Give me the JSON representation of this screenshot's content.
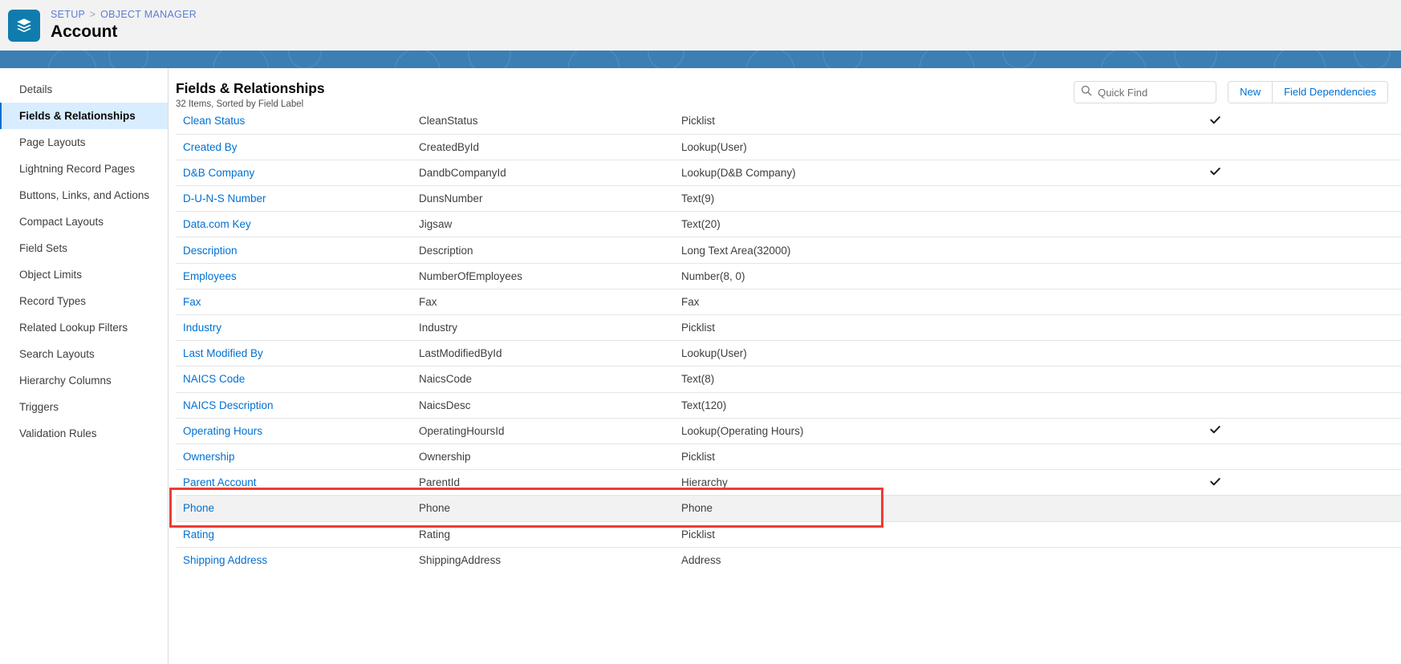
{
  "header": {
    "icon": "layers-stack-icon",
    "icon_bg": "#107cad",
    "breadcrumb": {
      "setup": "SETUP",
      "separator": ">",
      "object_manager": "OBJECT MANAGER"
    },
    "title": "Account"
  },
  "sidebar": {
    "items": [
      {
        "label": "Details",
        "active": false
      },
      {
        "label": "Fields & Relationships",
        "active": true
      },
      {
        "label": "Page Layouts",
        "active": false
      },
      {
        "label": "Lightning Record Pages",
        "active": false
      },
      {
        "label": "Buttons, Links, and Actions",
        "active": false
      },
      {
        "label": "Compact Layouts",
        "active": false
      },
      {
        "label": "Field Sets",
        "active": false
      },
      {
        "label": "Object Limits",
        "active": false
      },
      {
        "label": "Record Types",
        "active": false
      },
      {
        "label": "Related Lookup Filters",
        "active": false
      },
      {
        "label": "Search Layouts",
        "active": false
      },
      {
        "label": "Hierarchy Columns",
        "active": false
      },
      {
        "label": "Triggers",
        "active": false
      },
      {
        "label": "Validation Rules",
        "active": false
      }
    ]
  },
  "main": {
    "list_title": "Fields & Relationships",
    "list_subtitle": "32 Items, Sorted by Field Label",
    "search": {
      "icon": "search-icon",
      "placeholder": "Quick Find",
      "value": ""
    },
    "buttons": [
      {
        "label": "New"
      },
      {
        "label": "Field Dependencies"
      }
    ],
    "accent_link_color": "#0070d2",
    "highlight_color": "#ef3b35",
    "rows": [
      {
        "label": "Clean Status",
        "api_name": "CleanStatus",
        "data_type": "Picklist",
        "indexed": true,
        "highlighted": false
      },
      {
        "label": "Created By",
        "api_name": "CreatedById",
        "data_type": "Lookup(User)",
        "indexed": false,
        "highlighted": false
      },
      {
        "label": "D&B Company",
        "api_name": "DandbCompanyId",
        "data_type": "Lookup(D&B Company)",
        "indexed": true,
        "highlighted": false
      },
      {
        "label": "D-U-N-S Number",
        "api_name": "DunsNumber",
        "data_type": "Text(9)",
        "indexed": false,
        "highlighted": false
      },
      {
        "label": "Data.com Key",
        "api_name": "Jigsaw",
        "data_type": "Text(20)",
        "indexed": false,
        "highlighted": false
      },
      {
        "label": "Description",
        "api_name": "Description",
        "data_type": "Long Text Area(32000)",
        "indexed": false,
        "highlighted": false
      },
      {
        "label": "Employees",
        "api_name": "NumberOfEmployees",
        "data_type": "Number(8, 0)",
        "indexed": false,
        "highlighted": false
      },
      {
        "label": "Fax",
        "api_name": "Fax",
        "data_type": "Fax",
        "indexed": false,
        "highlighted": false
      },
      {
        "label": "Industry",
        "api_name": "Industry",
        "data_type": "Picklist",
        "indexed": false,
        "highlighted": false
      },
      {
        "label": "Last Modified By",
        "api_name": "LastModifiedById",
        "data_type": "Lookup(User)",
        "indexed": false,
        "highlighted": false
      },
      {
        "label": "NAICS Code",
        "api_name": "NaicsCode",
        "data_type": "Text(8)",
        "indexed": false,
        "highlighted": false
      },
      {
        "label": "NAICS Description",
        "api_name": "NaicsDesc",
        "data_type": "Text(120)",
        "indexed": false,
        "highlighted": false
      },
      {
        "label": "Operating Hours",
        "api_name": "OperatingHoursId",
        "data_type": "Lookup(Operating Hours)",
        "indexed": true,
        "highlighted": false
      },
      {
        "label": "Ownership",
        "api_name": "Ownership",
        "data_type": "Picklist",
        "indexed": false,
        "highlighted": false
      },
      {
        "label": "Parent Account",
        "api_name": "ParentId",
        "data_type": "Hierarchy",
        "indexed": true,
        "highlighted": false
      },
      {
        "label": "Phone",
        "api_name": "Phone",
        "data_type": "Phone",
        "indexed": false,
        "highlighted": true
      },
      {
        "label": "Rating",
        "api_name": "Rating",
        "data_type": "Picklist",
        "indexed": false,
        "highlighted": false
      },
      {
        "label": "Shipping Address",
        "api_name": "ShippingAddress",
        "data_type": "Address",
        "indexed": false,
        "highlighted": false
      }
    ]
  }
}
